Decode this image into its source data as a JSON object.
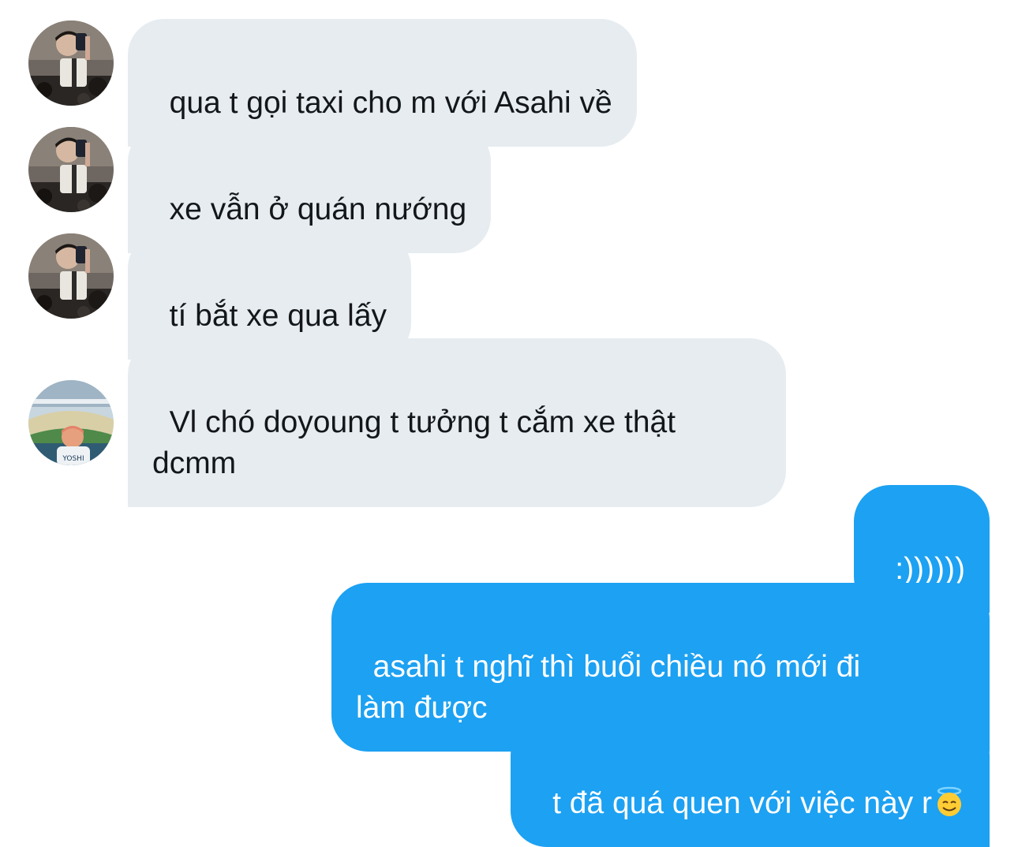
{
  "received": [
    {
      "text": "qua t gọi taxi cho m với Asahi về",
      "avatar": "avatar-mirror-selfie"
    },
    {
      "text": "xe vẫn ở quán nướng",
      "avatar": "avatar-mirror-selfie"
    },
    {
      "text": "tí bắt xe qua lấy",
      "avatar": "avatar-mirror-selfie"
    },
    {
      "text": "Vl chó doyoung t tưởng t cắm xe thật\ndcmm",
      "avatar": "avatar-stadium"
    }
  ],
  "sent": [
    {
      "text": ":))))))"
    },
    {
      "text": "asahi t nghĩ thì buổi chiều nó mới đi\nlàm được"
    },
    {
      "text": "t đã quá quen với việc này r",
      "emoji": "smiling-face-with-halo-icon"
    }
  ],
  "avatar_text": "YOSHI",
  "colors": {
    "received_bubble": "#e6ecf0",
    "received_text": "#14171a",
    "sent_bubble": "#1da1f2",
    "sent_text": "#ffffff"
  }
}
